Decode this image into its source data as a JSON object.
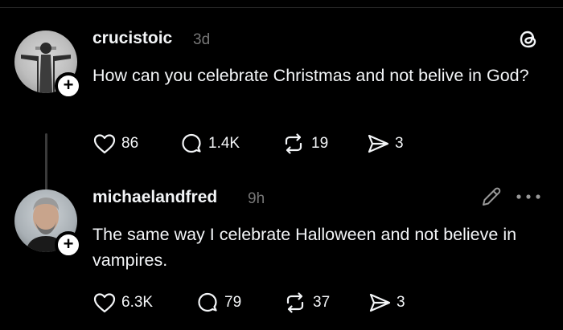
{
  "posts": [
    {
      "username": "crucistoic",
      "time": "3d",
      "text": "How can you celebrate Christmas and not belive in God?",
      "likes": "86",
      "replies": "1.4K",
      "reposts": "19",
      "shares": "3",
      "avatar_icon": "statue-avatar"
    },
    {
      "username": "michaelandfred",
      "time": "9h",
      "text": "The same way I celebrate Halloween and not believe in vampires.",
      "likes": "6.3K",
      "replies": "79",
      "reposts": "37",
      "shares": "3",
      "avatar_icon": "person-avatar"
    }
  ],
  "icons": {
    "follow": "plus-icon",
    "like": "heart-icon",
    "reply": "comment-icon",
    "repost": "repost-icon",
    "share": "send-icon",
    "app_logo": "threads-logo-icon",
    "edit": "pencil-icon",
    "more": "more-icon"
  },
  "colors": {
    "background": "#000000",
    "text": "#f3f5f7",
    "muted": "#777777"
  }
}
